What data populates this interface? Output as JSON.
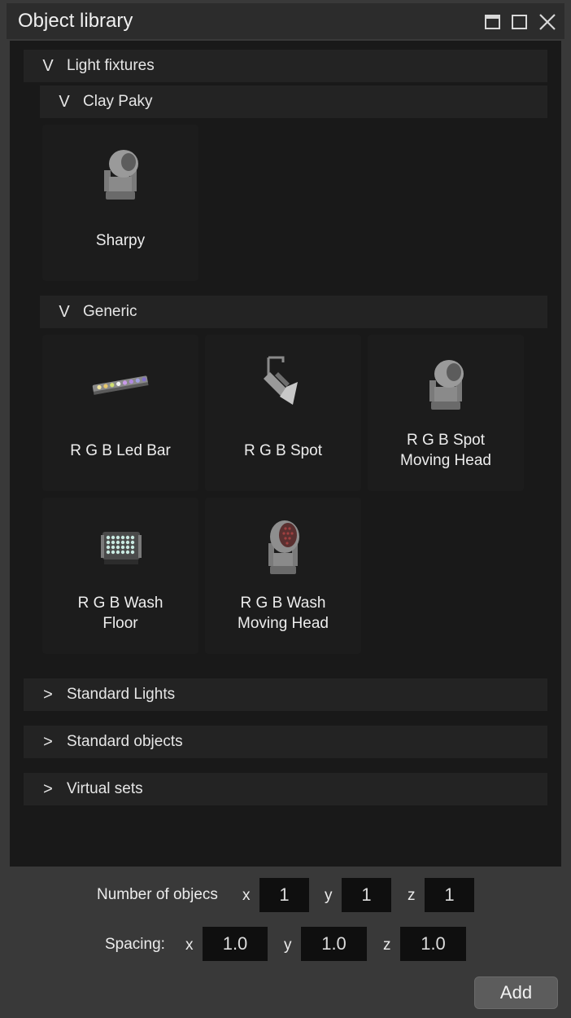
{
  "window": {
    "title": "Object library",
    "minimize_icon": "minimize-icon",
    "maximize_icon": "maximize-icon",
    "close_icon": "close-icon"
  },
  "library": {
    "light_fixtures": {
      "label": "Light fixtures",
      "expanded": true,
      "groups": {
        "clay_paky": {
          "label": "Clay Paky",
          "expanded": true,
          "items": [
            {
              "label": "Sharpy",
              "icon": "moving-head-icon"
            }
          ]
        },
        "generic": {
          "label": "Generic",
          "expanded": true,
          "items": [
            {
              "label": "R G B Led Bar",
              "icon": "led-bar-icon"
            },
            {
              "label": "R G B Spot",
              "icon": "spot-light-icon"
            },
            {
              "label": "R G B Spot\nMoving Head",
              "icon": "moving-head-icon"
            },
            {
              "label": "R G B Wash\nFloor",
              "icon": "wash-floor-icon"
            },
            {
              "label": "R G B Wash\nMoving Head",
              "icon": "wash-moving-head-icon"
            }
          ]
        }
      }
    },
    "standard_lights": {
      "label": "Standard Lights",
      "expanded": false
    },
    "standard_objects": {
      "label": "Standard objects",
      "expanded": false
    },
    "virtual_sets": {
      "label": "Virtual sets",
      "expanded": false
    },
    "expanded_glyph": "V",
    "collapsed_glyph": ">"
  },
  "footer": {
    "number_label": "Number of objecs",
    "spacing_label": "Spacing:",
    "axis_x": "x",
    "axis_y": "y",
    "axis_z": "z",
    "count": {
      "x": "1",
      "y": "1",
      "z": "1"
    },
    "spacing": {
      "x": "1.0",
      "y": "1.0",
      "z": "1.0"
    },
    "add_label": "Add"
  }
}
